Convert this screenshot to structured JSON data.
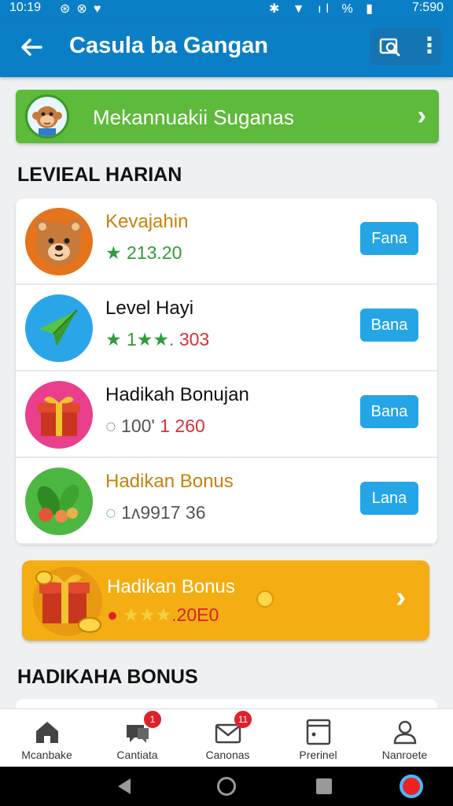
{
  "status_bar": {
    "time_left": "10:19",
    "time_right": "7:590",
    "battery_text": "%"
  },
  "app_bar": {
    "title": "Casula ba Gangan",
    "back_icon": "arrow-left-icon",
    "search_icon": "search-icon",
    "menu_icon": "more-vertical-icon"
  },
  "banner": {
    "label": "Mekannuakii Suganas",
    "avatar_icon": "monkey-avatar-icon",
    "color": "#5dba3b"
  },
  "sections": {
    "daily_title": "LEVIEAL HARIAN",
    "bonus_title": "HADIKAHA BONUS"
  },
  "list": {
    "items": [
      {
        "name": "Kevajahin",
        "sub_prefix": "★",
        "sub_value": "213.20",
        "button": "Fana",
        "icon": "bear-icon"
      },
      {
        "name": "Level Hayi",
        "sub_prefix": "★ 1★★.",
        "sub_value": "303",
        "button": "Bana",
        "icon": "paper-plane-icon"
      },
      {
        "name": "Hadikah Bonujan",
        "sub_prefix": "◌ 100'",
        "sub_value": "1 260",
        "button": "Bana",
        "icon": "gift-box-icon"
      },
      {
        "name": "Hadikan Bonus",
        "sub_prefix": "◌",
        "sub_value": "1ᴧ9917 36",
        "button": "Lana",
        "icon": "veggie-icon"
      }
    ]
  },
  "bonus_card": {
    "title": "Hadikan Bonus",
    "stars": "★★★",
    "value": ".20E0",
    "icon": "gift-coins-icon",
    "color": "#f4ae14"
  },
  "bottom_nav": {
    "items": [
      {
        "label": "Mcanbake",
        "icon": "home-icon",
        "badge": ""
      },
      {
        "label": "Cantiata",
        "icon": "chat-icon",
        "badge": "1"
      },
      {
        "label": "Canonas",
        "icon": "mail-icon",
        "badge": "11"
      },
      {
        "label": "Prerinel",
        "icon": "card-icon",
        "badge": ""
      },
      {
        "label": "Nanroete",
        "icon": "profile-icon",
        "badge": ""
      }
    ]
  }
}
